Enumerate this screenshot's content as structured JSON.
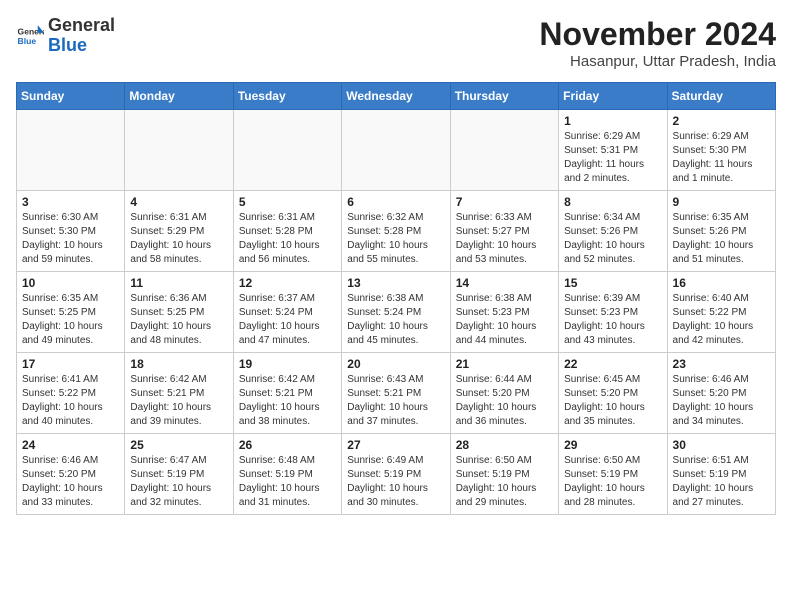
{
  "logo": {
    "general": "General",
    "blue": "Blue"
  },
  "title": "November 2024",
  "subtitle": "Hasanpur, Uttar Pradesh, India",
  "weekdays": [
    "Sunday",
    "Monday",
    "Tuesday",
    "Wednesday",
    "Thursday",
    "Friday",
    "Saturday"
  ],
  "weeks": [
    [
      {
        "day": "",
        "info": ""
      },
      {
        "day": "",
        "info": ""
      },
      {
        "day": "",
        "info": ""
      },
      {
        "day": "",
        "info": ""
      },
      {
        "day": "",
        "info": ""
      },
      {
        "day": "1",
        "info": "Sunrise: 6:29 AM\nSunset: 5:31 PM\nDaylight: 11 hours and 2 minutes."
      },
      {
        "day": "2",
        "info": "Sunrise: 6:29 AM\nSunset: 5:30 PM\nDaylight: 11 hours and 1 minute."
      }
    ],
    [
      {
        "day": "3",
        "info": "Sunrise: 6:30 AM\nSunset: 5:30 PM\nDaylight: 10 hours and 59 minutes."
      },
      {
        "day": "4",
        "info": "Sunrise: 6:31 AM\nSunset: 5:29 PM\nDaylight: 10 hours and 58 minutes."
      },
      {
        "day": "5",
        "info": "Sunrise: 6:31 AM\nSunset: 5:28 PM\nDaylight: 10 hours and 56 minutes."
      },
      {
        "day": "6",
        "info": "Sunrise: 6:32 AM\nSunset: 5:28 PM\nDaylight: 10 hours and 55 minutes."
      },
      {
        "day": "7",
        "info": "Sunrise: 6:33 AM\nSunset: 5:27 PM\nDaylight: 10 hours and 53 minutes."
      },
      {
        "day": "8",
        "info": "Sunrise: 6:34 AM\nSunset: 5:26 PM\nDaylight: 10 hours and 52 minutes."
      },
      {
        "day": "9",
        "info": "Sunrise: 6:35 AM\nSunset: 5:26 PM\nDaylight: 10 hours and 51 minutes."
      }
    ],
    [
      {
        "day": "10",
        "info": "Sunrise: 6:35 AM\nSunset: 5:25 PM\nDaylight: 10 hours and 49 minutes."
      },
      {
        "day": "11",
        "info": "Sunrise: 6:36 AM\nSunset: 5:25 PM\nDaylight: 10 hours and 48 minutes."
      },
      {
        "day": "12",
        "info": "Sunrise: 6:37 AM\nSunset: 5:24 PM\nDaylight: 10 hours and 47 minutes."
      },
      {
        "day": "13",
        "info": "Sunrise: 6:38 AM\nSunset: 5:24 PM\nDaylight: 10 hours and 45 minutes."
      },
      {
        "day": "14",
        "info": "Sunrise: 6:38 AM\nSunset: 5:23 PM\nDaylight: 10 hours and 44 minutes."
      },
      {
        "day": "15",
        "info": "Sunrise: 6:39 AM\nSunset: 5:23 PM\nDaylight: 10 hours and 43 minutes."
      },
      {
        "day": "16",
        "info": "Sunrise: 6:40 AM\nSunset: 5:22 PM\nDaylight: 10 hours and 42 minutes."
      }
    ],
    [
      {
        "day": "17",
        "info": "Sunrise: 6:41 AM\nSunset: 5:22 PM\nDaylight: 10 hours and 40 minutes."
      },
      {
        "day": "18",
        "info": "Sunrise: 6:42 AM\nSunset: 5:21 PM\nDaylight: 10 hours and 39 minutes."
      },
      {
        "day": "19",
        "info": "Sunrise: 6:42 AM\nSunset: 5:21 PM\nDaylight: 10 hours and 38 minutes."
      },
      {
        "day": "20",
        "info": "Sunrise: 6:43 AM\nSunset: 5:21 PM\nDaylight: 10 hours and 37 minutes."
      },
      {
        "day": "21",
        "info": "Sunrise: 6:44 AM\nSunset: 5:20 PM\nDaylight: 10 hours and 36 minutes."
      },
      {
        "day": "22",
        "info": "Sunrise: 6:45 AM\nSunset: 5:20 PM\nDaylight: 10 hours and 35 minutes."
      },
      {
        "day": "23",
        "info": "Sunrise: 6:46 AM\nSunset: 5:20 PM\nDaylight: 10 hours and 34 minutes."
      }
    ],
    [
      {
        "day": "24",
        "info": "Sunrise: 6:46 AM\nSunset: 5:20 PM\nDaylight: 10 hours and 33 minutes."
      },
      {
        "day": "25",
        "info": "Sunrise: 6:47 AM\nSunset: 5:19 PM\nDaylight: 10 hours and 32 minutes."
      },
      {
        "day": "26",
        "info": "Sunrise: 6:48 AM\nSunset: 5:19 PM\nDaylight: 10 hours and 31 minutes."
      },
      {
        "day": "27",
        "info": "Sunrise: 6:49 AM\nSunset: 5:19 PM\nDaylight: 10 hours and 30 minutes."
      },
      {
        "day": "28",
        "info": "Sunrise: 6:50 AM\nSunset: 5:19 PM\nDaylight: 10 hours and 29 minutes."
      },
      {
        "day": "29",
        "info": "Sunrise: 6:50 AM\nSunset: 5:19 PM\nDaylight: 10 hours and 28 minutes."
      },
      {
        "day": "30",
        "info": "Sunrise: 6:51 AM\nSunset: 5:19 PM\nDaylight: 10 hours and 27 minutes."
      }
    ]
  ]
}
